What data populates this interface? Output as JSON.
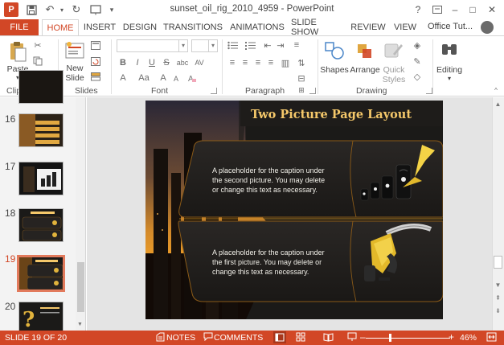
{
  "window": {
    "title": "sunset_oil_rig_2010_4959 - PowerPoint",
    "help": "?",
    "minimize": "–",
    "maximize": "□",
    "close": "✕"
  },
  "tabs": {
    "file": "FILE",
    "items": [
      "HOME",
      "INSERT",
      "DESIGN",
      "TRANSITIONS",
      "ANIMATIONS",
      "SLIDE SHOW",
      "REVIEW",
      "VIEW"
    ],
    "active": "HOME",
    "account": "Office Tut..."
  },
  "ribbon": {
    "groups": {
      "clipboard": "Clipboard",
      "slides": "Slides",
      "font": "Font",
      "paragraph": "Paragraph",
      "drawing": "Drawing"
    },
    "paste": "Paste",
    "new_slide_line1": "New",
    "new_slide_line2": "Slide",
    "shapes": "Shapes",
    "arrange": "Arrange",
    "quick_styles_line1": "Quick",
    "quick_styles_line2": "Styles",
    "editing": "Editing",
    "font_buttons": [
      "B",
      "I",
      "U",
      "S",
      "abc",
      "AV",
      "Aa",
      "A"
    ],
    "font_size_buttons": [
      "A",
      "A"
    ]
  },
  "thumbnails": {
    "numbers": [
      "16",
      "17",
      "18",
      "19",
      "20"
    ],
    "current": "19"
  },
  "slide": {
    "title": "Two Picture Page Layout",
    "caption_top": [
      "A placeholder for the caption under",
      "the second picture.  You may delete",
      "or change this text as necessary."
    ],
    "caption_bottom": [
      "A placeholder for the caption under",
      "the first picture.  You may delete or",
      "change this text as necessary."
    ]
  },
  "status": {
    "slide_info": "SLIDE 19 OF 20",
    "notes": "NOTES",
    "comments": "COMMENTS",
    "zoom_minus": "–",
    "zoom_plus": "+",
    "zoom": "46%"
  },
  "colors": {
    "accent": "#d24726",
    "slide_title": "#f5c86a",
    "slide_bg": "#2a2520",
    "panel_bg": "#1b1a18"
  },
  "icons": [
    "app-logo-icon",
    "save-icon",
    "undo-icon",
    "redo-icon",
    "slideshow-from-start-icon",
    "customize-qat-icon",
    "paste-icon",
    "cut-icon",
    "copy-icon",
    "format-painter-icon",
    "new-slide-icon",
    "shapes-icon",
    "arrange-icon",
    "quick-styles-icon",
    "find-icon",
    "notes-icon",
    "comments-icon",
    "normal-view-icon",
    "slide-sorter-icon",
    "reading-view-icon",
    "slideshow-view-icon",
    "fit-slide-icon"
  ]
}
